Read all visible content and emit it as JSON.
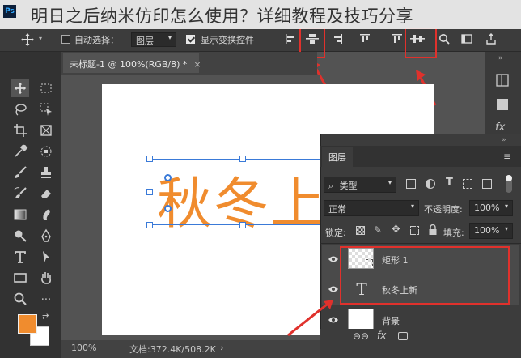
{
  "title_overlay": "明日之后纳米仿印怎么使用？详细教程及技巧分享",
  "options_bar": {
    "auto_select_label": "自动选择：",
    "auto_select_value": "图层",
    "show_transform_label": "显示变换控件",
    "auto_select_checked": false,
    "show_transform_checked": true
  },
  "document": {
    "tab_label": "未标题-1 @ 100%(RGB/8) *",
    "canvas_text": "秋冬上新",
    "zoom": "100%",
    "doc_info": "文档:372.4K/508.2K"
  },
  "colors": {
    "foreground": "#f08c2e",
    "background": "#ffffff",
    "annotation": "#e0312c",
    "selection": "#3a7ad8"
  },
  "layers_panel": {
    "tab_label": "图层",
    "filter_label": "类型",
    "blend_mode": "正常",
    "opacity_label": "不透明度:",
    "opacity_value": "100%",
    "lock_label": "锁定:",
    "fill_label": "填充:",
    "fill_value": "100%",
    "layers": [
      {
        "name": "矩形 1",
        "type": "shape",
        "visible": true,
        "selected": true
      },
      {
        "name": "秋冬上新",
        "type": "text",
        "visible": true,
        "selected": true
      },
      {
        "name": "背景",
        "type": "background",
        "visible": true,
        "selected": false
      }
    ]
  },
  "icons": {
    "move_tool": "move-icon",
    "align_vertical_centers": "align-vcenter-icon",
    "distribute_vertical_centers": "distribute-vcenter-icon"
  }
}
